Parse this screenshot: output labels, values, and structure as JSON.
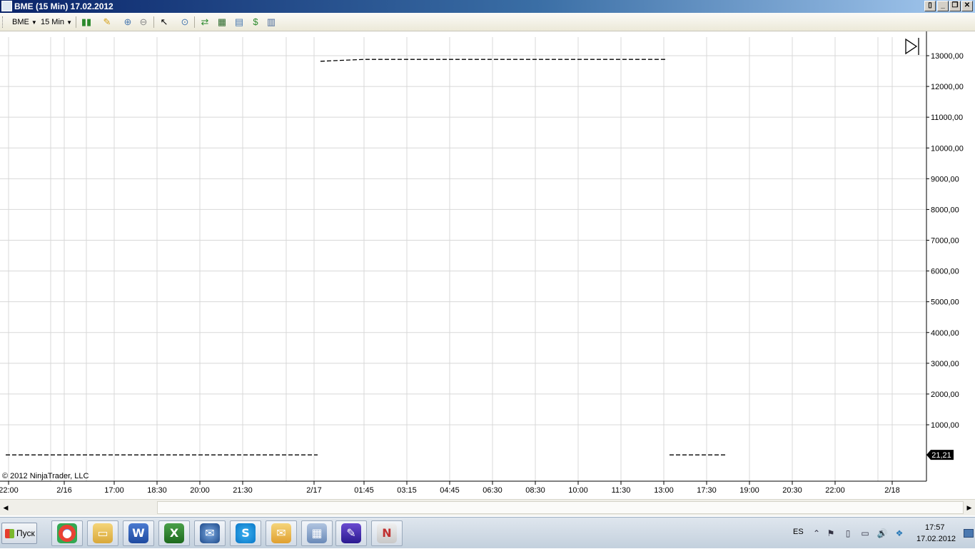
{
  "window": {
    "title": "BME (15 Min)  17.02.2012"
  },
  "toolbar": {
    "instrument": "BME",
    "interval": "15 Min"
  },
  "chart_data": {
    "type": "line",
    "style": "dashed price line",
    "ylabel": "",
    "xlabel": "",
    "ylim": [
      0,
      13300
    ],
    "y_ticks": [
      "13000,00",
      "12000,00",
      "11000,00",
      "10000,00",
      "9000,00",
      "8000,00",
      "7000,00",
      "6000,00",
      "5000,00",
      "4000,00",
      "3000,00",
      "2000,00",
      "1000,00"
    ],
    "x_ticks": [
      "22:00",
      "2/16",
      "17:00",
      "18:30",
      "20:00",
      "21:30",
      "2/17",
      "01:45",
      "03:15",
      "04:45",
      "06:30",
      "08:30",
      "10:00",
      "11:30",
      "13:00",
      "17:30",
      "19:00",
      "20:30",
      "22:00",
      "2/18"
    ],
    "grid": true,
    "series": [
      {
        "segment": "2/15 22:00 – 2/17 00:00",
        "x": [
          "2/15 22:00",
          "2/17 00:00"
        ],
        "y": [
          21.21,
          21.21
        ]
      },
      {
        "segment": "2/17 00:00 – 13:00",
        "x": [
          "2/17 00:00",
          "2/17 01:45",
          "2/17 13:00"
        ],
        "y": [
          12820,
          12880,
          12880
        ]
      },
      {
        "segment": "2/17 13:00 – 17:45",
        "x": [
          "2/17 13:00",
          "2/17 17:45"
        ],
        "y": [
          21.21,
          21.21
        ]
      }
    ],
    "last_price_label": "21,21",
    "copyright": "© 2012 NinjaTrader, LLC"
  },
  "taskbar": {
    "start_label": "Пуск",
    "apps": [
      "chrome-icon",
      "explorer-icon",
      "word-icon",
      "excel-icon",
      "thunderbird-icon",
      "skype-icon",
      "outlook-icon",
      "calculator-icon",
      "app-icon",
      "ninjatrader-icon"
    ],
    "language": "ES",
    "time": "17:57",
    "date": "17.02.2012"
  }
}
